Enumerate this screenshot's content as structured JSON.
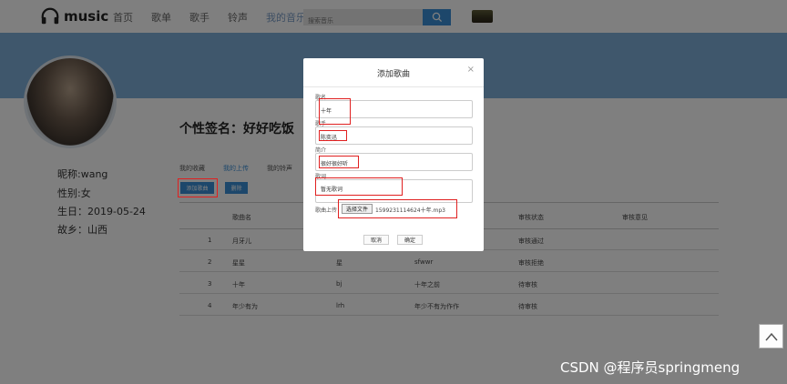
{
  "app": {
    "logo_text": "music"
  },
  "nav": {
    "items": [
      "首页",
      "歌单",
      "歌手",
      "铃声",
      "我的音乐"
    ],
    "active_index": 4
  },
  "search": {
    "placeholder": "搜索音乐"
  },
  "profile": {
    "signature": "个性签名：好好吃饭",
    "nickname": "昵称:wang",
    "gender": "性别:女",
    "birthday": "生日：2019-05-24",
    "hometown": "故乡：山西"
  },
  "tabs": {
    "items": [
      "我的收藏",
      "我的上传",
      "我的铃声"
    ],
    "active_index": 1
  },
  "actions": {
    "add_label": "添加歌曲",
    "delete_label": "删除"
  },
  "table": {
    "headers": [
      "歌曲名",
      "审核状态",
      "审核意见"
    ],
    "rows": [
      {
        "no": "1",
        "name": "月牙儿",
        "singer": "",
        "intro": "",
        "status": "审核通过"
      },
      {
        "no": "2",
        "name": "星星",
        "singer": "星",
        "intro": "sfwwr",
        "status": "审核拒绝"
      },
      {
        "no": "3",
        "name": "十年",
        "singer": "bj",
        "intro": "十年之前",
        "status": "待审核"
      },
      {
        "no": "4",
        "name": "年少有为",
        "singer": "lrh",
        "intro": "年少不有为作作",
        "status": "待审核"
      }
    ]
  },
  "modal": {
    "title": "添加歌曲",
    "close": "×",
    "fields": {
      "name": {
        "label": "歌名",
        "value": "十年"
      },
      "singer": {
        "label": "歌手",
        "value": "陈奕迅"
      },
      "intro": {
        "label": "简介",
        "value": "很好很好听"
      },
      "lyrics": {
        "label": "歌词",
        "value": "暂无歌词"
      },
      "upload": {
        "label": "歌曲上传",
        "button": "选择文件",
        "filename": "1599231114624十年.mp3"
      }
    },
    "cancel": "取消",
    "confirm": "确定"
  },
  "watermark": "CSDN @程序员springmeng",
  "colors": {
    "accent": "#3b8fd6",
    "banner": "#7eafd9",
    "annotation": "#e02020"
  }
}
